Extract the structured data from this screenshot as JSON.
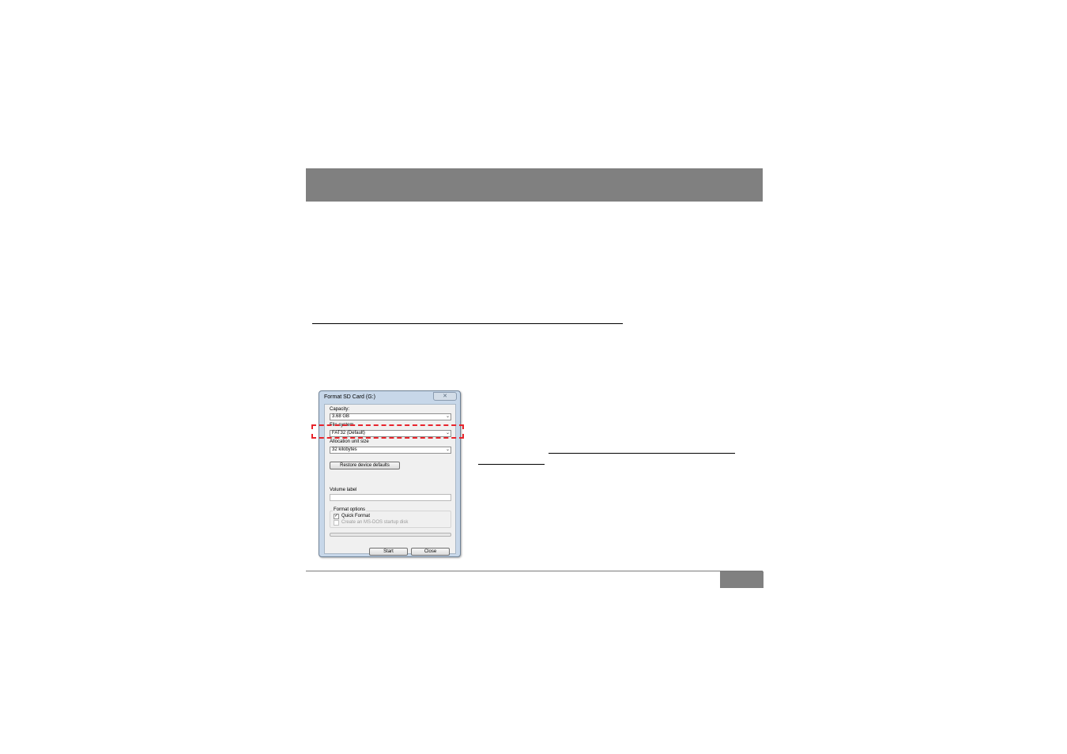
{
  "dialog": {
    "title": "Format SD Card (G:)",
    "close_glyph": "✕",
    "capacity_label": "Capacity:",
    "capacity_value": "3.68 GB",
    "filesystem_label": "File system",
    "filesystem_value": "FAT32 (Default)",
    "allocation_label": "Allocation unit size",
    "allocation_value": "32 kilobytes",
    "restore_button": "Restore device defaults",
    "volume_label": "Volume label",
    "volume_value": "",
    "format_options_title": "Format options",
    "quick_format_label": "Quick Format",
    "quick_format_checked": true,
    "quick_format_mark": "✓",
    "msdos_label": "Create an MS-DOS startup disk",
    "msdos_checked": false,
    "progress": 0,
    "start_button": "Start",
    "close_button": "Close"
  },
  "icons": {
    "dropdown_arrow": "⌄"
  },
  "colors": {
    "header_bar": "#808080",
    "highlight": "#e8242b",
    "dialog_frame": "#c7d7e9"
  }
}
